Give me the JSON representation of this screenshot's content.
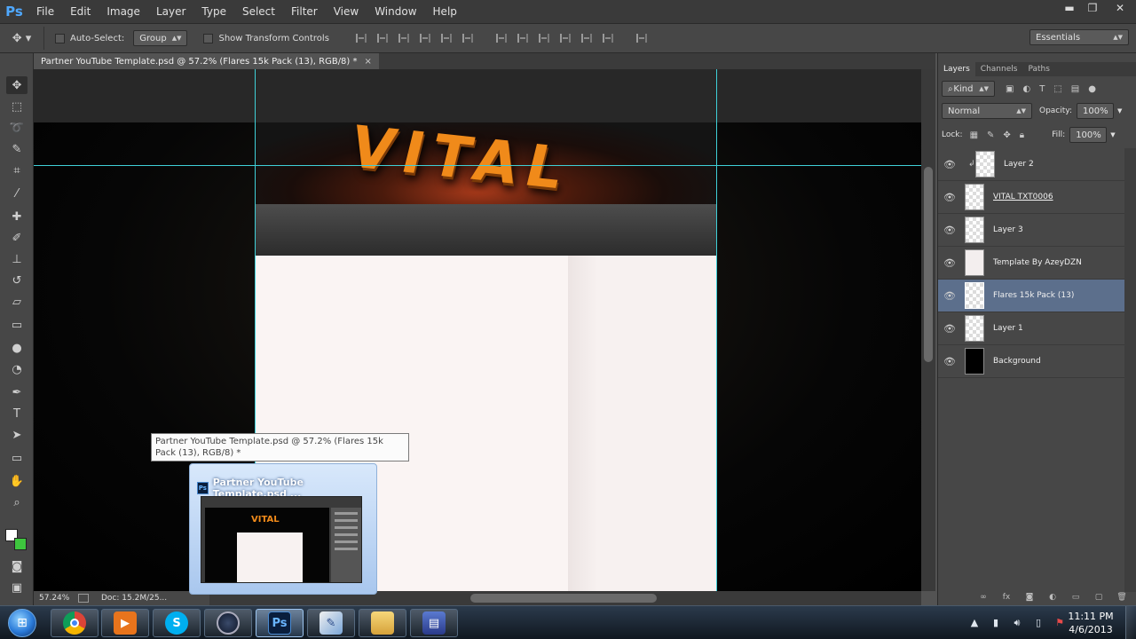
{
  "app": {
    "logo": "Ps"
  },
  "menu": [
    "File",
    "Edit",
    "Image",
    "Layer",
    "Type",
    "Select",
    "Filter",
    "View",
    "Window",
    "Help"
  ],
  "window_controls": {
    "minimize": "▬",
    "restore": "❐",
    "close": "✕"
  },
  "options": {
    "auto_select_label": "Auto-Select:",
    "auto_select_value": "Group",
    "show_transform_label": "Show Transform Controls",
    "workspace": "Essentials"
  },
  "document": {
    "tab_title": "Partner YouTube Template.psd @ 57.2% (Flares 15k Pack (13), RGB/8) *",
    "tab_close": "×",
    "banner_text": "VITAL"
  },
  "status": {
    "zoom": "57.24%",
    "doc": "Doc: 15.2M/25..."
  },
  "layers_panel": {
    "tabs": [
      "Layers",
      "Channels",
      "Paths"
    ],
    "filter_label": "Kind",
    "blend_mode": "Normal",
    "opacity_label": "Opacity:",
    "opacity_value": "100%",
    "lock_label": "Lock:",
    "fill_label": "Fill:",
    "fill_value": "100%",
    "layers": [
      {
        "name": "Layer 2"
      },
      {
        "name": "VITAL TXT0006"
      },
      {
        "name": "Layer 3"
      },
      {
        "name": "Template By AzeyDZN"
      },
      {
        "name": "Flares 15k Pack (13)"
      },
      {
        "name": "Layer 1"
      },
      {
        "name": "Background"
      }
    ]
  },
  "taskbar_preview": {
    "tooltip": "Partner YouTube Template.psd @ 57.2% (Flares 15k Pack (13), RGB/8) *",
    "title": "Partner YouTube Template.psd ...",
    "mini_logo": "VITAL"
  },
  "clock": {
    "time": "11:11 PM",
    "date": "4/6/2013"
  },
  "colors": {
    "accent": "#5c6f8c",
    "guide": "#3fd0d8",
    "banner_text": "#f08a1a"
  }
}
